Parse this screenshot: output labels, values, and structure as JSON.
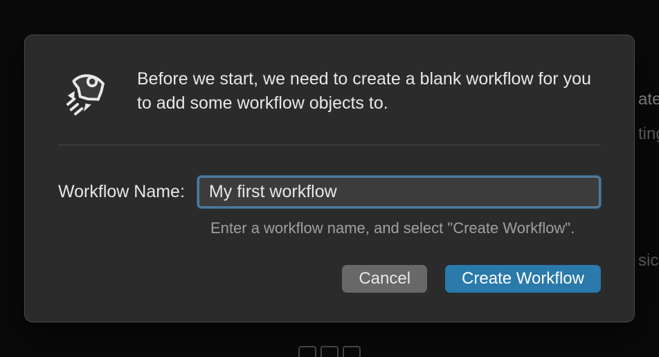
{
  "dialog": {
    "header_text": "Before we start, we need to create a blank workflow for you to add some workflow objects to.",
    "form": {
      "label": "Workflow Name:",
      "value": "My first workflow",
      "help_text": "Enter a workflow name, and select \"Create Workflow\"."
    },
    "buttons": {
      "cancel": "Cancel",
      "create": "Create Workflow"
    }
  },
  "background": {
    "right_text_1": "ate",
    "right_text_2": "ting",
    "right_text_3": "sics"
  }
}
